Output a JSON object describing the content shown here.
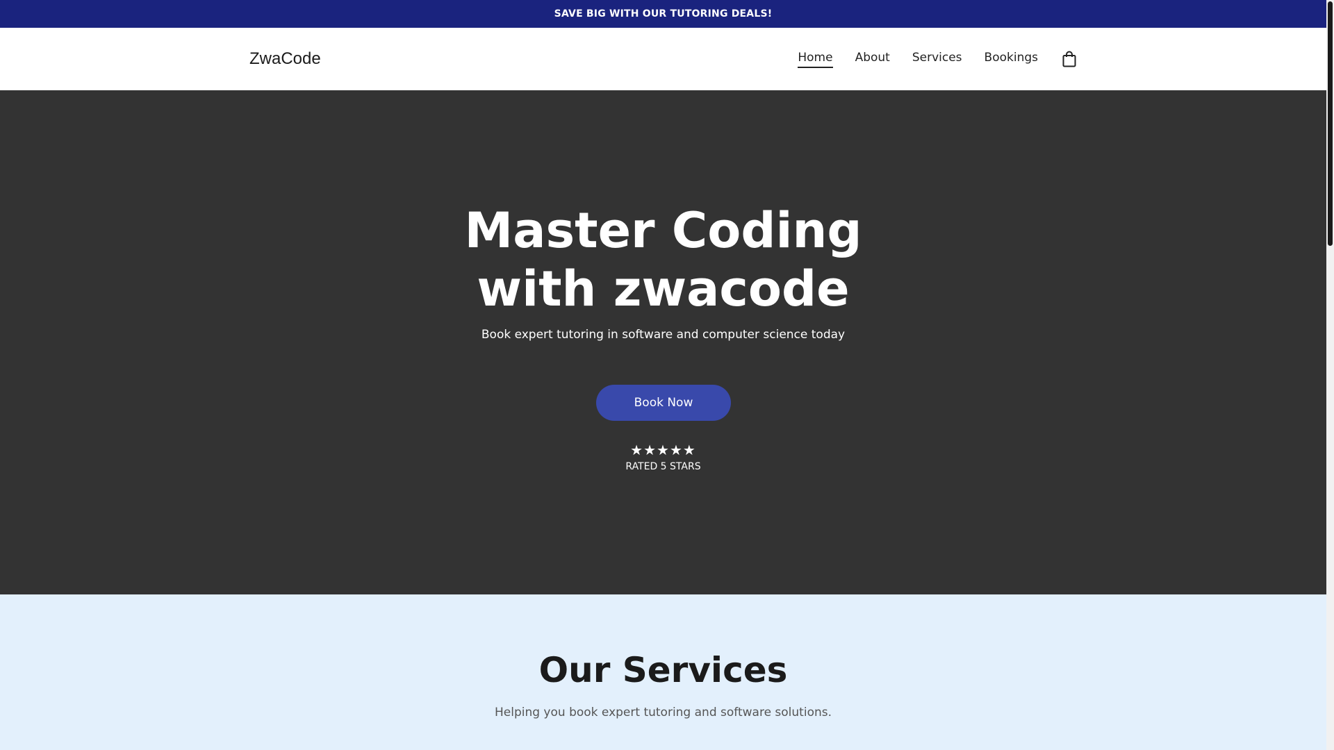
{
  "announcement": {
    "text": "SAVE BIG WITH OUR TUTORING DEALS!"
  },
  "header": {
    "logo": "ZwaCode",
    "nav": [
      {
        "label": "Home",
        "active": true
      },
      {
        "label": "About",
        "active": false
      },
      {
        "label": "Services",
        "active": false
      },
      {
        "label": "Bookings",
        "active": false
      }
    ],
    "cart_icon": "shopping-bag-icon"
  },
  "hero": {
    "title": "Master Coding with zwacode",
    "subtitle": "Book expert tutoring in software and computer science today",
    "button_label": "Book Now",
    "stars": "★★★★★",
    "rating_text": "RATED 5 STARS"
  },
  "services": {
    "title": "Our Services",
    "subtitle": "Helping you book expert tutoring and software solutions."
  },
  "colors": {
    "announcement_bg": "#1a237e",
    "hero_bg": "#333333",
    "button_bg": "#3949ab",
    "services_bg": "#e3f0fc"
  }
}
